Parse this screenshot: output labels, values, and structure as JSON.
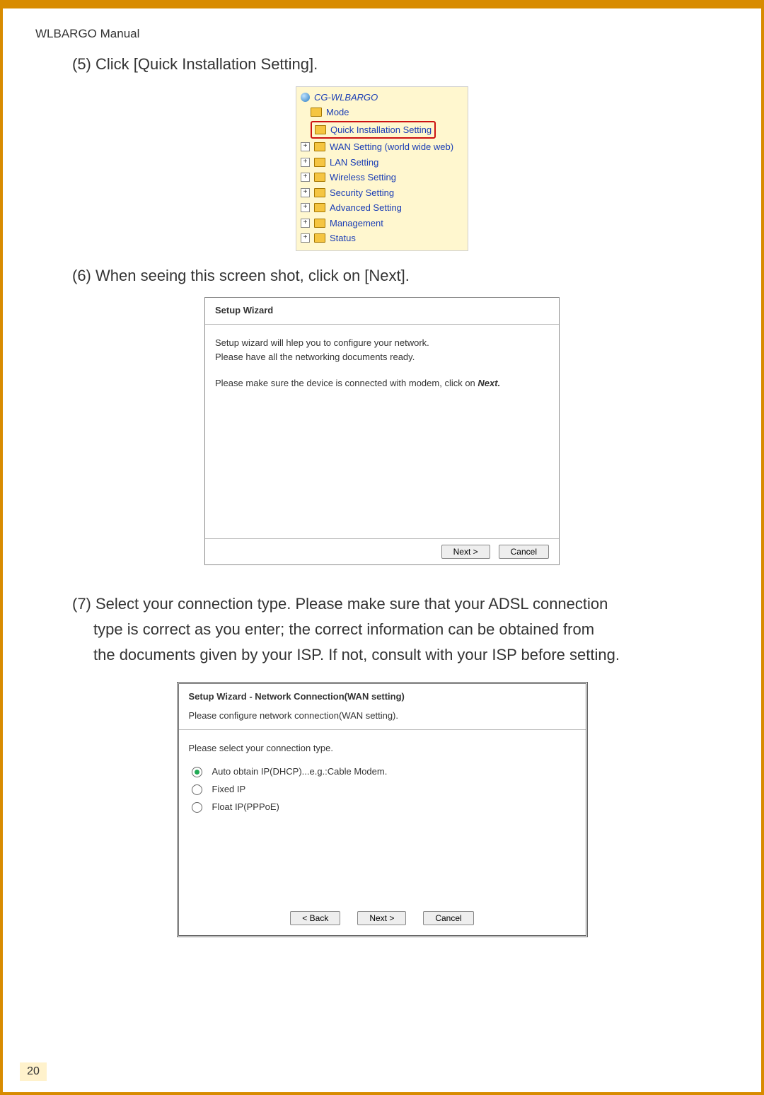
{
  "manual_title": "WLBARGO Manual",
  "page_number": "20",
  "step5": "(5) Click [Quick Installation Setting].",
  "tree": {
    "root": "CG-WLBARGO",
    "items": [
      "Mode",
      "Quick Installation Setting",
      "WAN Setting (world wide web)",
      "LAN Setting",
      "Wireless Setting",
      "Security Setting",
      "Advanced Setting",
      "Management",
      "Status"
    ]
  },
  "step6": "(6) When seeing this screen shot, click on [Next].",
  "wizard1": {
    "title": "Setup Wizard",
    "line1": "Setup wizard will hlep you to configure your network.",
    "line2": "Please have all the networking documents ready.",
    "line3_pre": "Please make sure the device is connected with modem, click on ",
    "line3_bold": "Next.",
    "btn_next": "Next >",
    "btn_cancel": "Cancel"
  },
  "step7a": "(7) Select your connection type. Please make sure that your ADSL connection",
  "step7b": "type is correct as you enter; the correct information can be obtained from",
  "step7c": "the documents given by your ISP. If not, consult with your ISP before setting.",
  "wizard2": {
    "title": "Setup Wizard - Network Connection(WAN setting)",
    "subtitle": "Please configure network connection(WAN setting).",
    "intro": "Please select your connection type.",
    "opt1": "Auto obtain IP(DHCP)...e.g.:Cable Modem.",
    "opt2": "Fixed IP",
    "opt3": "Float IP(PPPoE)",
    "btn_back": "< Back",
    "btn_next": "Next >",
    "btn_cancel": "Cancel"
  }
}
